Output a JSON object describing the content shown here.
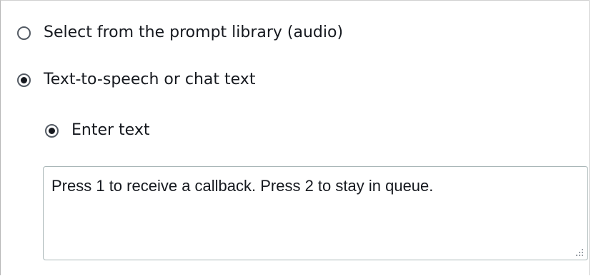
{
  "prompt_source": {
    "options": [
      {
        "label": "Select from the prompt library (audio)",
        "selected": false
      },
      {
        "label": "Text-to-speech or chat text",
        "selected": true
      }
    ],
    "text_entry": {
      "option_label": "Enter text",
      "selected": true,
      "value": "Press 1 to receive a callback. Press 2 to stay in queue."
    }
  },
  "colors": {
    "text": "#16191f",
    "radio_border": "#545b64",
    "input_border": "#aab7b8"
  },
  "icons": {
    "resize": "resize-grip-icon"
  }
}
